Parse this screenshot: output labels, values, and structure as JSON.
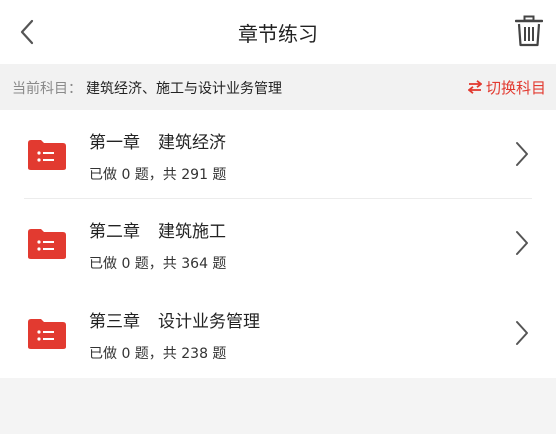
{
  "header": {
    "title": "章节练习",
    "icons": {
      "back": "chevron-left-icon",
      "delete": "trash-icon"
    }
  },
  "subject": {
    "label": "当前科目：",
    "value": "建筑经济、施工与设计业务管理",
    "switch_label": "切换科目",
    "switch_icon": "swap-arrows-icon"
  },
  "chapters": [
    {
      "number": "第一章",
      "name": "建筑经济",
      "progress": "已做 0 题，共 291 题"
    },
    {
      "number": "第二章",
      "name": "建筑施工",
      "progress": "已做 0 题，共 364 题"
    },
    {
      "number": "第三章",
      "name": "设计业务管理",
      "progress": "已做 0 题，共 238 题"
    }
  ],
  "colors": {
    "accent": "#e23a30",
    "folder": "#e23a30",
    "background": "#f4f4f4"
  }
}
